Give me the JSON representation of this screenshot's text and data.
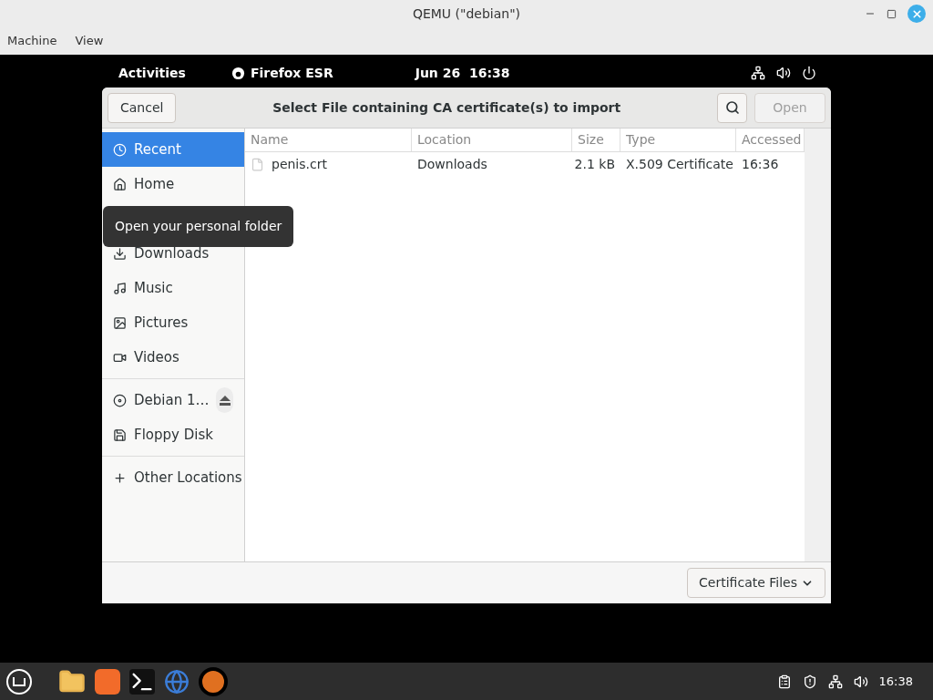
{
  "window": {
    "title": "QEMU (\"debian\")"
  },
  "menu": [
    "Machine",
    "View"
  ],
  "top_bar": {
    "activities": "Activities",
    "app": "Firefox ESR",
    "clock": "Jun 26  16:38"
  },
  "dialog": {
    "cancel": "Cancel",
    "title": "Select File containing CA certificate(s) to import",
    "open": {
      "label": "Open",
      "disabled": true
    },
    "sidebar": [
      {
        "kind": "recent",
        "label": "Recent",
        "selected": true
      },
      {
        "kind": "home",
        "label": "Home",
        "selected": false
      },
      {
        "kind": "covered"
      },
      {
        "kind": "downloads",
        "label": "Downloads",
        "selected": false
      },
      {
        "kind": "music",
        "label": "Music",
        "selected": false
      },
      {
        "kind": "pictures",
        "label": "Pictures",
        "selected": false
      },
      {
        "kind": "videos",
        "label": "Videos",
        "selected": false
      },
      {
        "kind": "separator"
      },
      {
        "kind": "disc",
        "label": "Debian 1…",
        "selected": false,
        "eject": true
      },
      {
        "kind": "floppy",
        "label": "Floppy Disk",
        "selected": false
      },
      {
        "kind": "separator"
      },
      {
        "kind": "other",
        "label": "Other Locations",
        "selected": false
      }
    ],
    "tooltip": "Open your personal folder",
    "table": {
      "columns": [
        "Name",
        "Location",
        "Size",
        "Type",
        "Accessed"
      ],
      "rows": [
        {
          "name": "penis.crt",
          "location": "Downloads",
          "size": "2.1 kB",
          "type": "X.509 Certificate",
          "accessed": "16:36"
        }
      ]
    },
    "filter": "Certificate Files"
  },
  "taskbar": {
    "clock": "16:38"
  }
}
